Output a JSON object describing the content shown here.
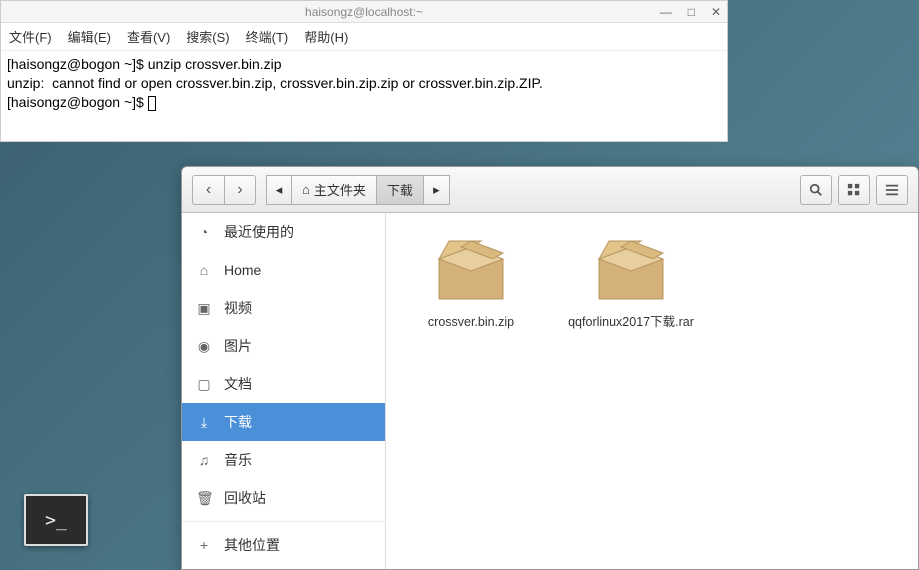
{
  "terminal": {
    "title": "haisongz@localhost:~",
    "menus": [
      "文件(F)",
      "编辑(E)",
      "查看(V)",
      "搜索(S)",
      "终端(T)",
      "帮助(H)"
    ],
    "lines": [
      "[haisongz@bogon ~]$ unzip crossver.bin.zip",
      "unzip:  cannot find or open crossver.bin.zip, crossver.bin.zip.zip or crossver.bin.zip.ZIP.",
      "[haisongz@bogon ~]$ "
    ],
    "ctrl_min": "—",
    "ctrl_max": "□",
    "ctrl_close": "✕"
  },
  "filemanager": {
    "nav_back": "‹",
    "nav_fwd": "›",
    "path_prev": "◂",
    "path_home_label": "主文件夹",
    "path_current": "下载",
    "path_next": "▸",
    "sidebar": [
      {
        "icon": "◔",
        "label": "最近使用的",
        "sel": false
      },
      {
        "icon": "⌂",
        "label": "Home",
        "sel": false
      },
      {
        "icon": "▣",
        "label": "视频",
        "sel": false
      },
      {
        "icon": "◉",
        "label": "图片",
        "sel": false
      },
      {
        "icon": "▢",
        "label": "文档",
        "sel": false
      },
      {
        "icon": "⤓",
        "label": "下载",
        "sel": true
      },
      {
        "icon": "♫",
        "label": "音乐",
        "sel": false
      },
      {
        "icon": "🗑",
        "label": "回收站",
        "sel": false
      }
    ],
    "other_loc": {
      "icon": "+",
      "label": "其他位置"
    },
    "files": [
      {
        "name": "crossver.bin.zip"
      },
      {
        "name": "qqforlinux2017下载.rar"
      }
    ]
  }
}
